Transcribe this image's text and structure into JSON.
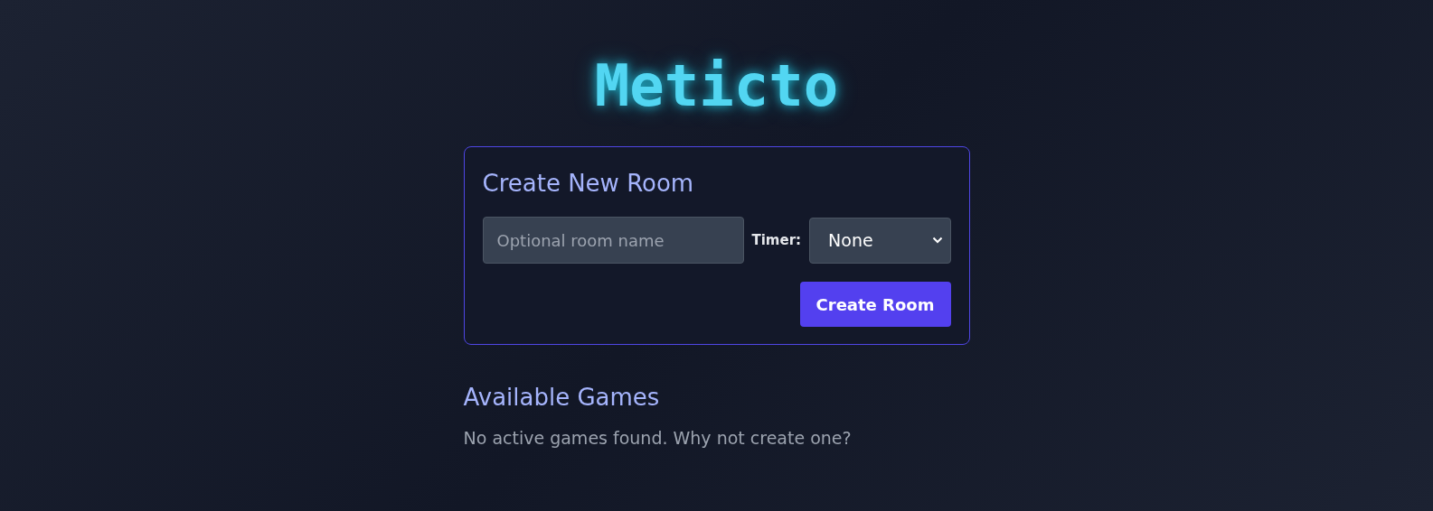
{
  "logo": "Meticto",
  "create_room": {
    "title": "Create New Room",
    "room_name": {
      "placeholder": "Optional room name"
    },
    "timer": {
      "label": "Timer:",
      "value": "None"
    },
    "button": "Create Room"
  },
  "available_games": {
    "title": "Available Games",
    "empty_message": "No active games found. Why not create one?"
  }
}
